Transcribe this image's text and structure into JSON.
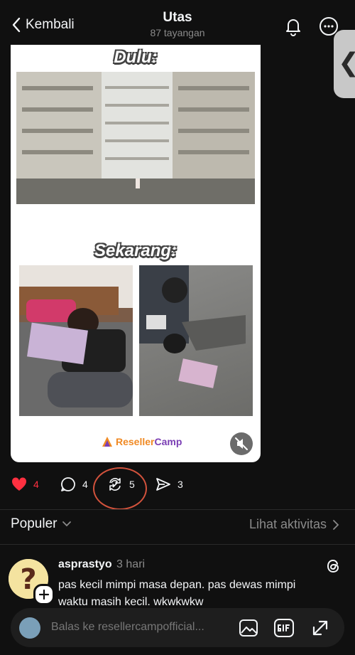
{
  "header": {
    "back_label": "Kembali",
    "title": "Utas",
    "views": "87 tayangan",
    "side_tab_glyph": "❮"
  },
  "post": {
    "caption_top": "Dulu:",
    "caption_bottom": "Sekarang:",
    "logo_text_a": "Reseller",
    "logo_text_b": "Camp",
    "likes": "4",
    "comments": "4",
    "reposts": "5",
    "shares": "3"
  },
  "section": {
    "sort_label": "Populer",
    "activity_label": "Lihat aktivitas"
  },
  "reply": {
    "username": "asprastyo",
    "time": "3 hari",
    "text": "pas kecil mimpi masa depan. pas dewas mimpi waktu masih kecil. wkwkwkw"
  },
  "composer": {
    "placeholder": "Balas ke resellercampofficial..."
  },
  "colors": {
    "background": "#101010",
    "like_red": "#ff3040",
    "highlight_ring": "#d2523c"
  }
}
